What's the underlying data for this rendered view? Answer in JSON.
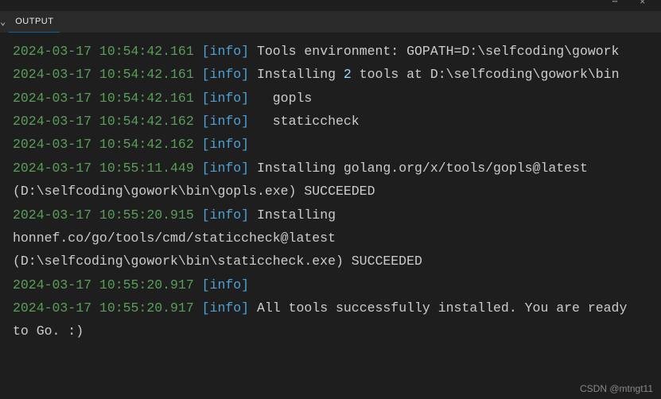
{
  "topBar": {
    "leftIcon": "⋯",
    "rightIcon": "✕"
  },
  "tabs": {
    "chevron": "⌄",
    "active": "OUTPUT"
  },
  "logs": [
    {
      "timestamp": "2024-03-17 10:54:42.161",
      "level": "[info]",
      "segments": [
        {
          "type": "msg",
          "text": " Tools environment: GOPATH=D:\\selfcoding\\gowork"
        }
      ]
    },
    {
      "timestamp": "2024-03-17 10:54:42.161",
      "level": "[info]",
      "segments": [
        {
          "type": "msg",
          "text": " Installing "
        },
        {
          "type": "num",
          "text": "2"
        },
        {
          "type": "msg",
          "text": " tools at D:\\selfcoding\\gowork\\bin"
        }
      ]
    },
    {
      "timestamp": "2024-03-17 10:54:42.161",
      "level": "[info]",
      "segments": [
        {
          "type": "msg",
          "text": "   gopls"
        }
      ]
    },
    {
      "timestamp": "2024-03-17 10:54:42.162",
      "level": "[info]",
      "segments": [
        {
          "type": "msg",
          "text": "   staticcheck"
        }
      ]
    },
    {
      "timestamp": "2024-03-17 10:54:42.162",
      "level": "[info]",
      "segments": [
        {
          "type": "msg",
          "text": " "
        }
      ]
    },
    {
      "timestamp": "2024-03-17 10:55:11.449",
      "level": "[info]",
      "segments": [
        {
          "type": "msg",
          "text": " Installing golang.org/x/tools/gopls@latest (D:\\selfcoding\\gowork\\bin\\gopls.exe) SUCCEEDED"
        }
      ]
    },
    {
      "timestamp": "2024-03-17 10:55:20.915",
      "level": "[info]",
      "segments": [
        {
          "type": "msg",
          "text": " Installing honnef.co/go/tools/cmd/staticcheck@latest (D:\\selfcoding\\gowork\\bin\\staticcheck.exe) SUCCEEDED"
        }
      ]
    },
    {
      "timestamp": "2024-03-17 10:55:20.917",
      "level": "[info]",
      "segments": [
        {
          "type": "msg",
          "text": " "
        }
      ]
    },
    {
      "timestamp": "2024-03-17 10:55:20.917",
      "level": "[info]",
      "segments": [
        {
          "type": "msg",
          "text": " All tools successfully installed. You are ready to Go. :)"
        }
      ]
    }
  ],
  "watermark": "CSDN @mtngt11"
}
